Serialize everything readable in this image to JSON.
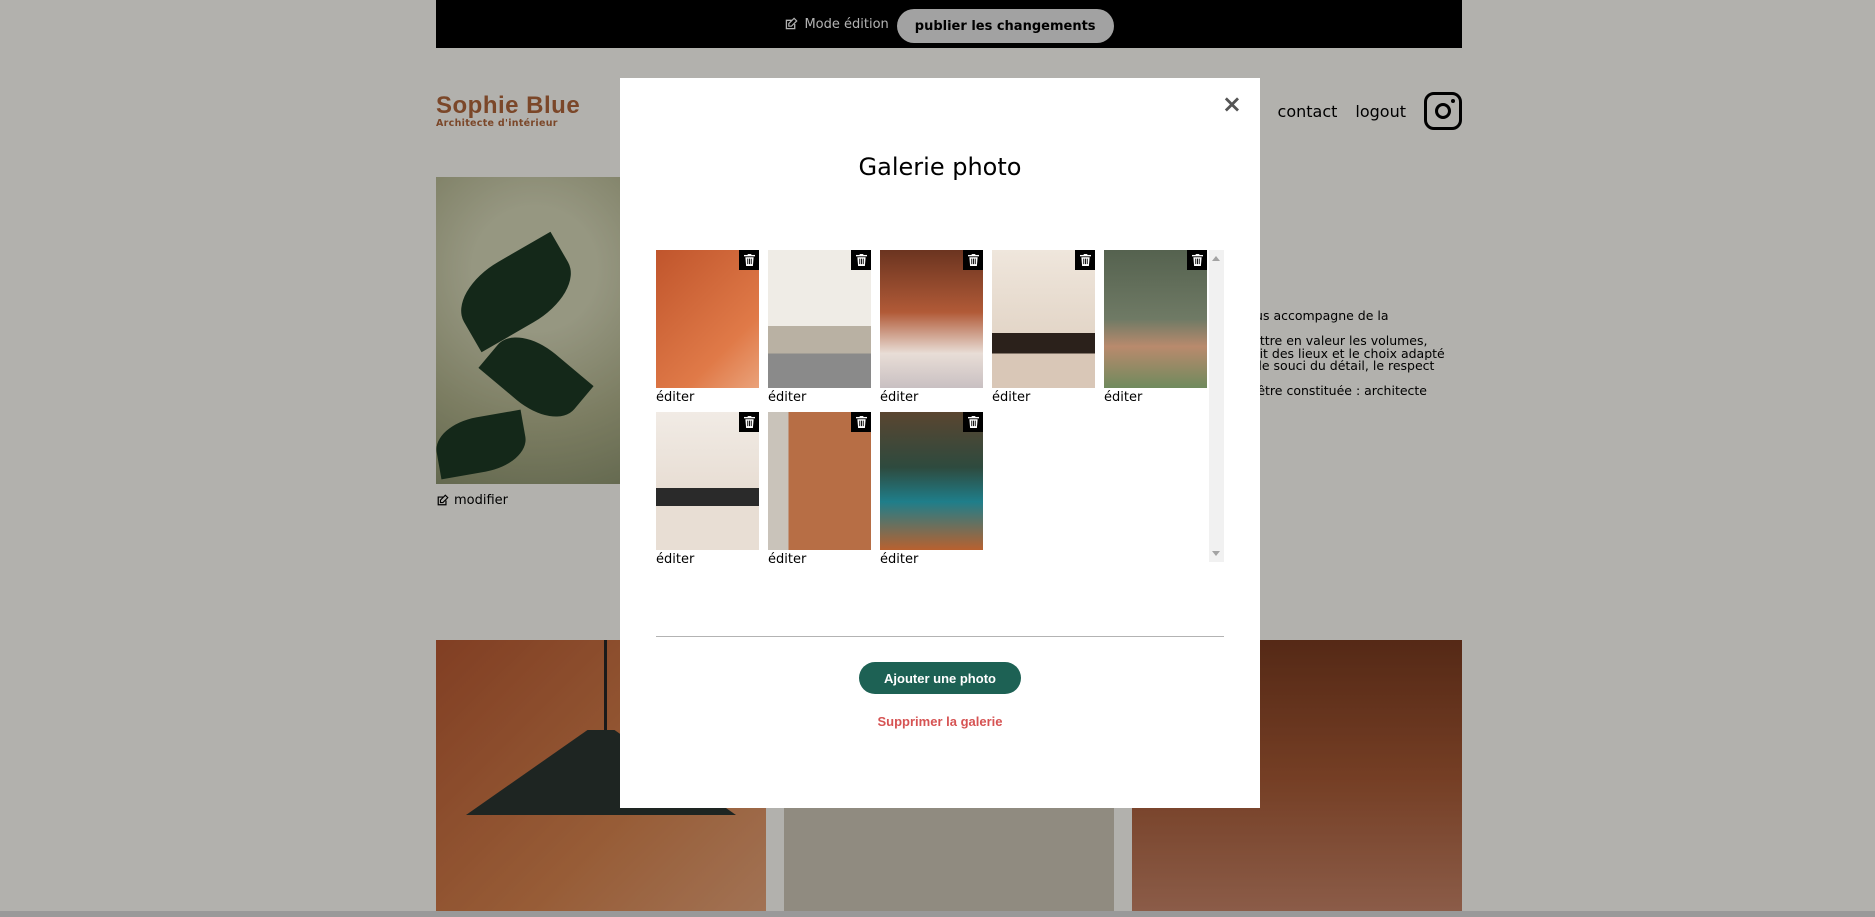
{
  "editbar": {
    "mode_label": "Mode édition",
    "publish_label": "publier les changements"
  },
  "header": {
    "logo_name": "Sophie Blue",
    "logo_tagline": "Architecte d'intérieur",
    "nav": {
      "contact": "contact",
      "logout": "logout"
    }
  },
  "intro": {
    "modify_label": "modifier",
    "text_lines": [
      "vous accompagne de la",
      "",
      "mettre en valeur les volumes,",
      "sprit des lieux et le choix adapté",
      "ns le souci du détail, le respect",
      "",
      "ut-être constituée : architecte"
    ]
  },
  "modal": {
    "title": "Galerie photo",
    "close_label": "×",
    "edit_label": "éditer",
    "add_button": "Ajouter une photo",
    "delete_link": "Supprimer la galerie",
    "photos": [
      {
        "name": "photo-lamp",
        "bg": "linear-gradient(135deg,#c0552c,#e07a48 70%,#eaa27a)"
      },
      {
        "name": "photo-living-room",
        "bg": "linear-gradient(180deg,#efece6 0 55%,#b9b1a3 55% 75%,#8a8a8a 75%)"
      },
      {
        "name": "photo-restaurant-greenhouse",
        "bg": "linear-gradient(180deg,#6b3420,#b15a37 45%,#e8ddd6 75%,#c9c0c2)"
      },
      {
        "name": "photo-arches",
        "bg": "linear-gradient(180deg,#efe6dc,#e3d6c8 60%,#2b211b 60% 75%,#d9c7b7 75%)"
      },
      {
        "name": "photo-green-room",
        "bg": "linear-gradient(180deg,#55624f,#6f7a65 50%,#b98a6d 70%,#6f8a5d)"
      },
      {
        "name": "photo-white-arch",
        "bg": "linear-gradient(180deg,#f1ebe5,#e8ded4 55%,#2a2a2a 55% 68%,#e8ded4 68%)"
      },
      {
        "name": "photo-bedroom",
        "bg": "linear-gradient(90deg,#c9c3ba 0 20%,#b76e45 20% 100%)"
      },
      {
        "name": "photo-bar",
        "bg": "linear-gradient(180deg,#5a4530,#2e4a3e 40%,#1f7e8a 65%,#b9612f)"
      }
    ]
  }
}
